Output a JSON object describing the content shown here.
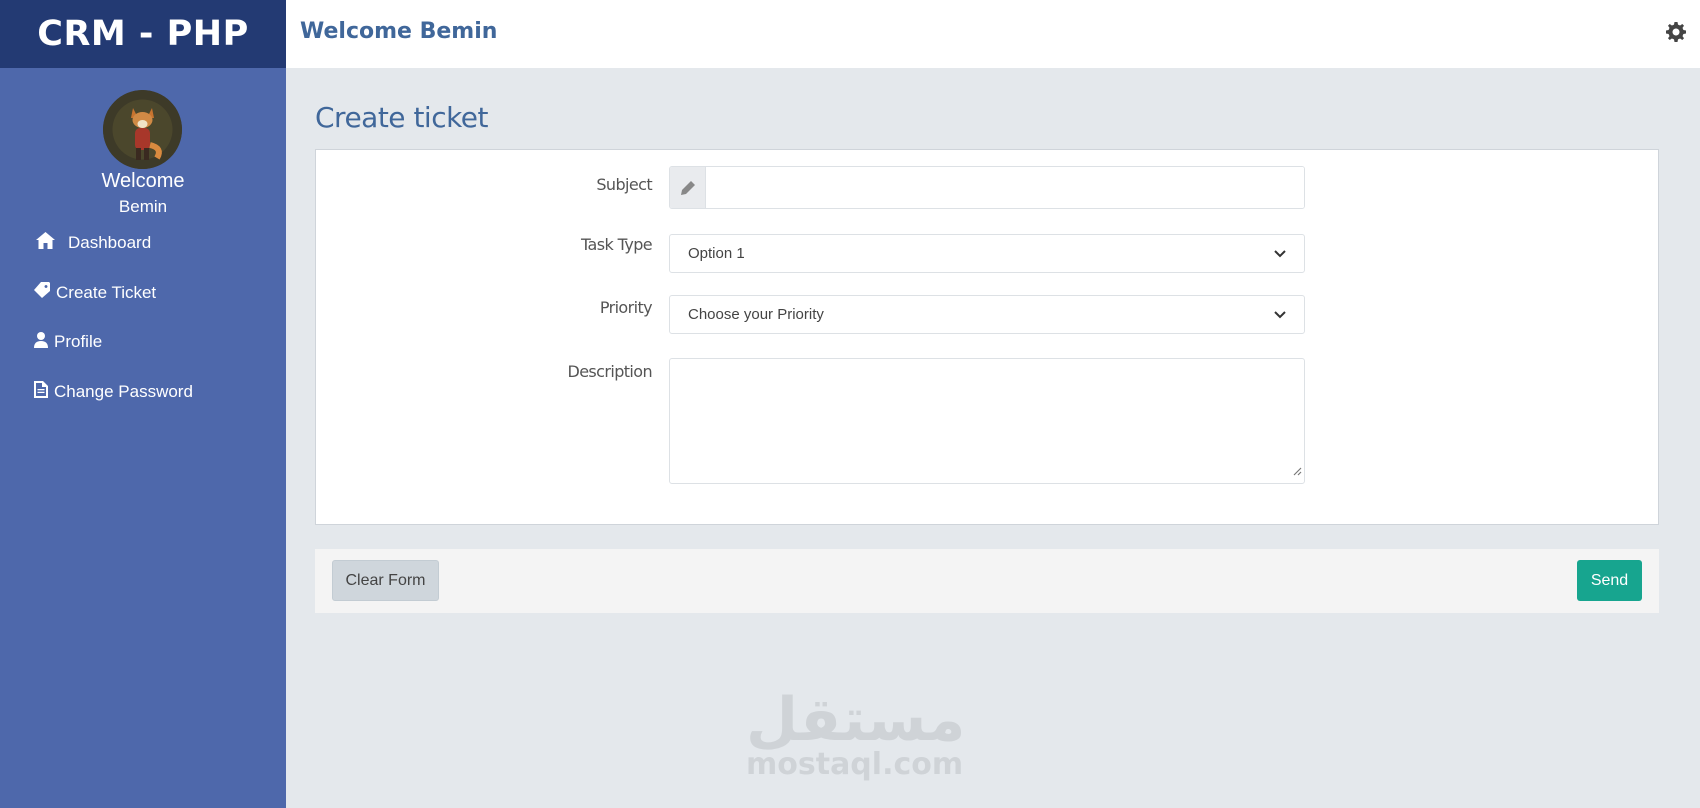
{
  "brand": {
    "title": "CRM - PHP"
  },
  "user": {
    "welcome": "Welcome",
    "name": "Bemin"
  },
  "sidebar": {
    "items": [
      {
        "label": "Dashboard",
        "icon": "home-icon"
      },
      {
        "label": "Create Ticket",
        "icon": "ticket-icon"
      },
      {
        "label": "Profile",
        "icon": "user-icon"
      },
      {
        "label": "Change Password",
        "icon": "file-icon"
      }
    ]
  },
  "topbar": {
    "title": "Welcome Bemin",
    "icon": "gear-icon"
  },
  "page": {
    "title": "Create ticket"
  },
  "form": {
    "subject": {
      "label": "Subject",
      "value": "",
      "icon": "pencil-icon"
    },
    "task_type": {
      "label": "Task Type",
      "selected": "Option 1"
    },
    "priority": {
      "label": "Priority",
      "selected": "Choose your Priority"
    },
    "description": {
      "label": "Description",
      "value": ""
    }
  },
  "actions": {
    "clear": "Clear Form",
    "send": "Send"
  },
  "watermark": {
    "arabic": "مستقل",
    "latin": "mostaql.com"
  },
  "colors": {
    "sidebar": "#4e68ab",
    "brand_bar": "#233a73",
    "accent_text": "#40679a",
    "send_button": "#17a58f",
    "background": "#e4e8ec"
  }
}
